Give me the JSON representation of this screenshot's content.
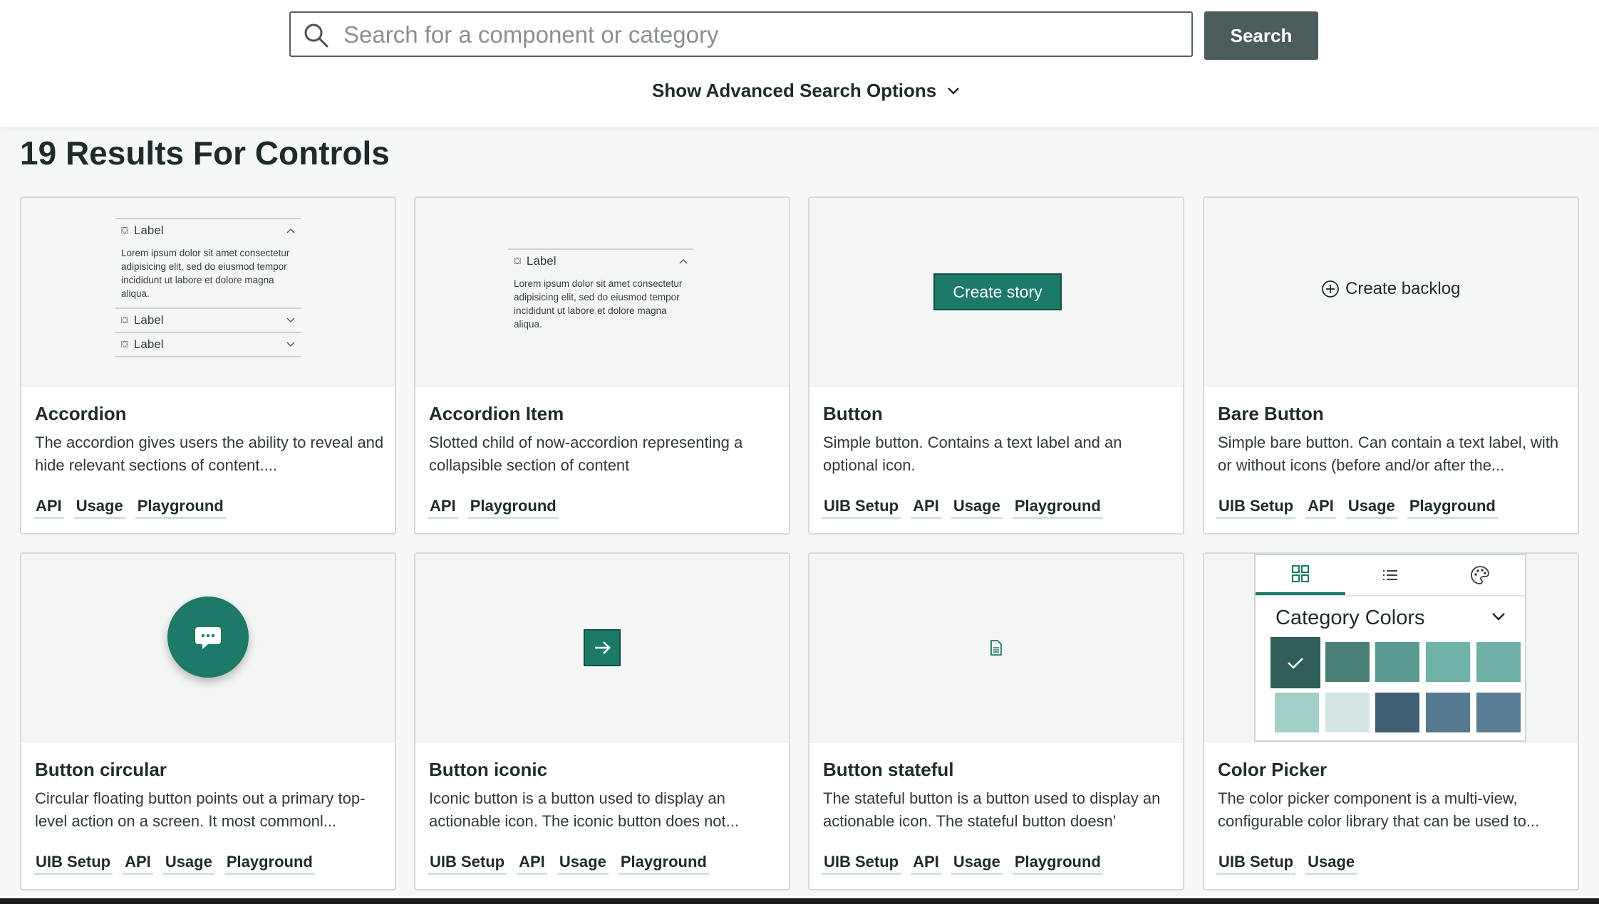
{
  "search": {
    "placeholder": "Search for a component or category",
    "button_label": "Search",
    "advanced_label": "Show Advanced Search Options"
  },
  "results_title": "19 Results For Controls",
  "colors": {
    "brand": "#1d7a68",
    "brand_dark": "#0f4f43",
    "search_button": "#4a5c5b"
  },
  "cards": [
    {
      "title": "Accordion",
      "description": "The accordion gives users the ability to reveal and hide relevant sections of content....",
      "links": [
        "API",
        "Usage",
        "Playground"
      ],
      "preview": {
        "item1_label": "Label",
        "item1_body": "Lorem ipsum dolor sit amet consectetur adipisicing elit, sed do eiusmod tempor incididunt ut labore et dolore magna aliqua.",
        "item2_label": "Label",
        "item3_label": "Label"
      }
    },
    {
      "title": "Accordion Item",
      "description": "Slotted child of now-accordion representing a collapsible section of content",
      "links": [
        "API",
        "Playground"
      ],
      "preview": {
        "item_label": "Label",
        "item_body": "Lorem ipsum dolor sit amet consectetur adipisicing elit, sed do eiusmod tempor incididunt ut labore et dolore magna aliqua."
      }
    },
    {
      "title": "Button",
      "description": "Simple button. Contains a text label and an optional icon.",
      "links": [
        "UIB Setup",
        "API",
        "Usage",
        "Playground"
      ],
      "preview": {
        "button_label": "Create story"
      }
    },
    {
      "title": "Bare Button",
      "description": "Simple bare button. Can contain a text label, with or without icons (before and/or after the...",
      "links": [
        "UIB Setup",
        "API",
        "Usage",
        "Playground"
      ],
      "preview": {
        "button_label": "Create backlog"
      }
    },
    {
      "title": "Button circular",
      "description": "Circular floating button points out a primary top-level action on a screen. It most commonl...",
      "links": [
        "UIB Setup",
        "API",
        "Usage",
        "Playground"
      ],
      "preview": {
        "icon": "chat-bubble-icon"
      }
    },
    {
      "title": "Button iconic",
      "description": "Iconic button is a button used to display an actionable icon. The iconic button does not...",
      "links": [
        "UIB Setup",
        "API",
        "Usage",
        "Playground"
      ],
      "preview": {
        "icon": "arrow-right-icon"
      }
    },
    {
      "title": "Button stateful",
      "description": "The stateful button is a button used to display an actionable icon. The stateful button doesn'",
      "links": [
        "UIB Setup",
        "API",
        "Usage",
        "Playground"
      ],
      "preview": {
        "icon": "document-icon"
      }
    },
    {
      "title": "Color Picker",
      "description": "The color picker component is a multi-view, configurable color library that can be used to...",
      "links": [
        "UIB Setup",
        "Usage"
      ],
      "preview": {
        "heading": "Category Colors",
        "swatches": [
          "#2f5f58",
          "#4a7f78",
          "#5a9a90",
          "#6fb2a8",
          "#6fb0a6",
          "#a2cfc8",
          "#d3e6e3",
          "#3f5f73",
          "#557a92",
          "#5a7f95"
        ]
      }
    }
  ]
}
